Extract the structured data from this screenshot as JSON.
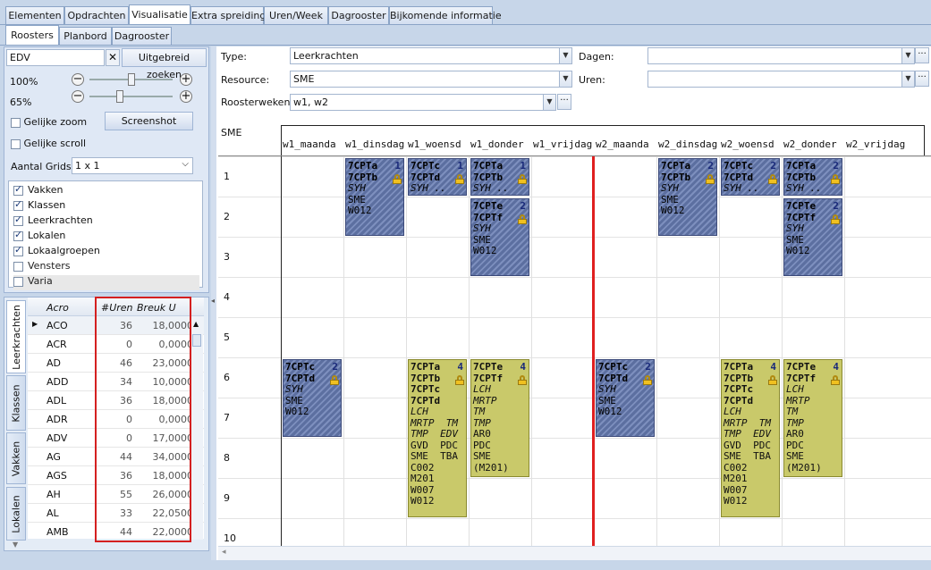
{
  "main_tabs": [
    "Elementen",
    "Opdrachten",
    "Visualisatie",
    "Extra spreidingen",
    "Uren/Week",
    "Dagrooster",
    "Bijkomende informatie"
  ],
  "sub_tabs": [
    "Roosters",
    "Planbord",
    "Dagrooster"
  ],
  "search": {
    "value": "EDV",
    "advanced": "Uitgebreid zoeken"
  },
  "zoom": {
    "z1": "100%",
    "z2": "65%"
  },
  "options": {
    "same_zoom": "Gelijke zoom",
    "same_scroll": "Gelijke scroll",
    "screenshot": "Screenshot",
    "grids_label": "Aantal Grids",
    "grids_value": "1 x 1"
  },
  "checklist": [
    {
      "label": "Vakken",
      "checked": true
    },
    {
      "label": "Klassen",
      "checked": true
    },
    {
      "label": "Leerkrachten",
      "checked": true
    },
    {
      "label": "Lokalen",
      "checked": true
    },
    {
      "label": "Lokaalgroepen",
      "checked": true
    },
    {
      "label": "Vensters",
      "checked": false
    },
    {
      "label": "Varia",
      "checked": false
    }
  ],
  "side_tabs": [
    "Leerkrachten",
    "Klassen",
    "Vakken",
    "Lokalen"
  ],
  "table": {
    "headers": [
      "Acro",
      "#Uren",
      "Breuk U"
    ],
    "rows": [
      [
        "ACO",
        "36",
        "18,0000"
      ],
      [
        "ACR",
        "0",
        "0,0000"
      ],
      [
        "AD",
        "46",
        "23,0000"
      ],
      [
        "ADD",
        "34",
        "10,0000"
      ],
      [
        "ADL",
        "36",
        "18,0000"
      ],
      [
        "ADR",
        "0",
        "0,0000"
      ],
      [
        "ADV",
        "0",
        "17,0000"
      ],
      [
        "AG",
        "44",
        "34,0000"
      ],
      [
        "AGS",
        "36",
        "18,0000"
      ],
      [
        "AH",
        "55",
        "26,0000"
      ],
      [
        "AL",
        "33",
        "22,0500"
      ],
      [
        "AMB",
        "44",
        "22,0000"
      ]
    ]
  },
  "filters": {
    "type_label": "Type:",
    "type_value": "Leerkrachten",
    "resource_label": "Resource:",
    "resource_value": "SME",
    "weeks_label": "Roosterweken:",
    "weeks_value": "w1, w2",
    "days_label": "Dagen:",
    "hours_label": "Uren:",
    "ellipsis": "···"
  },
  "schedule": {
    "owner": "SME",
    "days": [
      "w1_maanda",
      "w1_dinsdag",
      "w1_woensd",
      "w1_donder",
      "w1_vrijdag",
      "w2_maanda",
      "w2_dinsdag",
      "w2_woensd",
      "w2_donder",
      "w2_vrijdag"
    ],
    "periods": [
      "1",
      "2",
      "3",
      "4",
      "5",
      "6",
      "7",
      "8",
      "9",
      "10"
    ],
    "blocks": [
      {
        "col": 1,
        "row": 0,
        "span": 2,
        "style": "hatch",
        "num": "1",
        "lines": [
          [
            "b",
            "7CPTa"
          ],
          [
            "b",
            "7CPTb"
          ],
          [
            "i",
            "SYH"
          ],
          [
            "",
            "SME"
          ],
          [
            "",
            "W012"
          ]
        ]
      },
      {
        "col": 2,
        "row": 0,
        "span": 1,
        "style": "hatch",
        "num": "1",
        "lines": [
          [
            "b",
            "7CPTc"
          ],
          [
            "b",
            "7CPTd"
          ],
          [
            "i",
            "SYH .."
          ]
        ]
      },
      {
        "col": 3,
        "row": 0,
        "span": 1,
        "style": "hatch",
        "num": "1",
        "lines": [
          [
            "b",
            "7CPTa"
          ],
          [
            "b",
            "7CPTb"
          ],
          [
            "i",
            "SYH .."
          ]
        ]
      },
      {
        "col": 3,
        "row": 1,
        "span": 2,
        "style": "hatch",
        "num": "2",
        "lines": [
          [
            "b",
            "7CPTe"
          ],
          [
            "b",
            "7CPTf"
          ],
          [
            "i",
            "SYH"
          ],
          [
            "",
            "SME"
          ],
          [
            "",
            "W012"
          ]
        ]
      },
      {
        "col": 6,
        "row": 0,
        "span": 2,
        "style": "hatch",
        "num": "2",
        "lines": [
          [
            "b",
            "7CPTa"
          ],
          [
            "b",
            "7CPTb"
          ],
          [
            "i",
            "SYH"
          ],
          [
            "",
            "SME"
          ],
          [
            "",
            "W012"
          ]
        ]
      },
      {
        "col": 7,
        "row": 0,
        "span": 1,
        "style": "hatch",
        "num": "2",
        "lines": [
          [
            "b",
            "7CPTc"
          ],
          [
            "b",
            "7CPTd"
          ],
          [
            "i",
            "SYH .."
          ]
        ]
      },
      {
        "col": 8,
        "row": 0,
        "span": 1,
        "style": "hatch",
        "num": "2",
        "lines": [
          [
            "b",
            "7CPTa"
          ],
          [
            "b",
            "7CPTb"
          ],
          [
            "i",
            "SYH .."
          ]
        ]
      },
      {
        "col": 8,
        "row": 1,
        "span": 2,
        "style": "hatch",
        "num": "2",
        "lines": [
          [
            "b",
            "7CPTe"
          ],
          [
            "b",
            "7CPTf"
          ],
          [
            "i",
            "SYH"
          ],
          [
            "",
            "SME"
          ],
          [
            "",
            "W012"
          ]
        ]
      },
      {
        "col": 0,
        "row": 5,
        "span": 2,
        "style": "hatch",
        "num": "2",
        "lines": [
          [
            "b",
            "7CPTc"
          ],
          [
            "b",
            "7CPTd"
          ],
          [
            "i",
            "SYH"
          ],
          [
            "",
            "SME"
          ],
          [
            "",
            "W012"
          ]
        ]
      },
      {
        "col": 2,
        "row": 5,
        "span": 4,
        "style": "yellow",
        "num": "4",
        "lines": [
          [
            "b",
            "7CPTa"
          ],
          [
            "b",
            "7CPTb"
          ],
          [
            "b",
            "7CPTc"
          ],
          [
            "b",
            "7CPTd"
          ],
          [
            "i",
            "LCH"
          ],
          [
            "i",
            "MRTP  TM"
          ],
          [
            "i",
            "TMP  EDV"
          ],
          [
            "",
            "GVD  PDC"
          ],
          [
            "",
            "SME  TBA"
          ],
          [
            "",
            "C002"
          ],
          [
            "",
            "M201"
          ],
          [
            "",
            "W007"
          ],
          [
            "",
            "W012"
          ]
        ]
      },
      {
        "col": 3,
        "row": 5,
        "span": 3,
        "style": "yellow",
        "num": "4",
        "lines": [
          [
            "b",
            "7CPTe"
          ],
          [
            "b",
            "7CPTf"
          ],
          [
            "i",
            "LCH"
          ],
          [
            "i",
            "MRTP"
          ],
          [
            "i",
            "TM"
          ],
          [
            "i",
            "TMP"
          ],
          [
            "",
            "AR0"
          ],
          [
            "",
            "PDC"
          ],
          [
            "",
            "SME"
          ],
          [
            "",
            "(M201)"
          ]
        ]
      },
      {
        "col": 5,
        "row": 5,
        "span": 2,
        "style": "hatch",
        "num": "2",
        "lines": [
          [
            "b",
            "7CPTc"
          ],
          [
            "b",
            "7CPTd"
          ],
          [
            "i",
            "SYH"
          ],
          [
            "",
            "SME"
          ],
          [
            "",
            "W012"
          ]
        ]
      },
      {
        "col": 7,
        "row": 5,
        "span": 4,
        "style": "yellow",
        "num": "4",
        "lines": [
          [
            "b",
            "7CPTa"
          ],
          [
            "b",
            "7CPTb"
          ],
          [
            "b",
            "7CPTc"
          ],
          [
            "b",
            "7CPTd"
          ],
          [
            "i",
            "LCH"
          ],
          [
            "i",
            "MRTP  TM"
          ],
          [
            "i",
            "TMP  EDV"
          ],
          [
            "",
            "GVD  PDC"
          ],
          [
            "",
            "SME  TBA"
          ],
          [
            "",
            "C002"
          ],
          [
            "",
            "M201"
          ],
          [
            "",
            "W007"
          ],
          [
            "",
            "W012"
          ]
        ]
      },
      {
        "col": 8,
        "row": 5,
        "span": 3,
        "style": "yellow",
        "num": "4",
        "lines": [
          [
            "b",
            "7CPTe"
          ],
          [
            "b",
            "7CPTf"
          ],
          [
            "i",
            "LCH"
          ],
          [
            "i",
            "MRTP"
          ],
          [
            "i",
            "TM"
          ],
          [
            "i",
            "TMP"
          ],
          [
            "",
            "AR0"
          ],
          [
            "",
            "PDC"
          ],
          [
            "",
            "SME"
          ],
          [
            "",
            "(M201)"
          ]
        ]
      }
    ]
  }
}
